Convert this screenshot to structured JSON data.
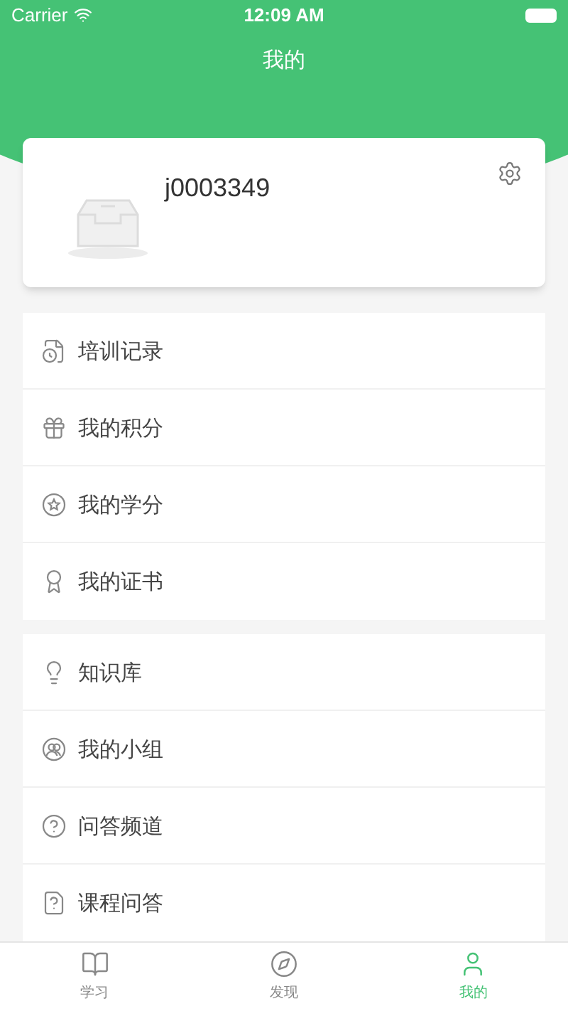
{
  "status_bar": {
    "carrier": "Carrier",
    "time": "12:09 AM"
  },
  "header": {
    "title": "我的"
  },
  "profile": {
    "username": "j0003349"
  },
  "menu_groups": [
    {
      "items": [
        {
          "label": "培训记录"
        },
        {
          "label": "我的积分"
        },
        {
          "label": "我的学分"
        },
        {
          "label": "我的证书"
        }
      ]
    },
    {
      "items": [
        {
          "label": "知识库"
        },
        {
          "label": "我的小组"
        },
        {
          "label": "问答频道"
        },
        {
          "label": "课程问答"
        }
      ]
    }
  ],
  "tab_bar": [
    {
      "label": "学习",
      "selected": false
    },
    {
      "label": "发现",
      "selected": false
    },
    {
      "label": "我的",
      "selected": true
    }
  ]
}
